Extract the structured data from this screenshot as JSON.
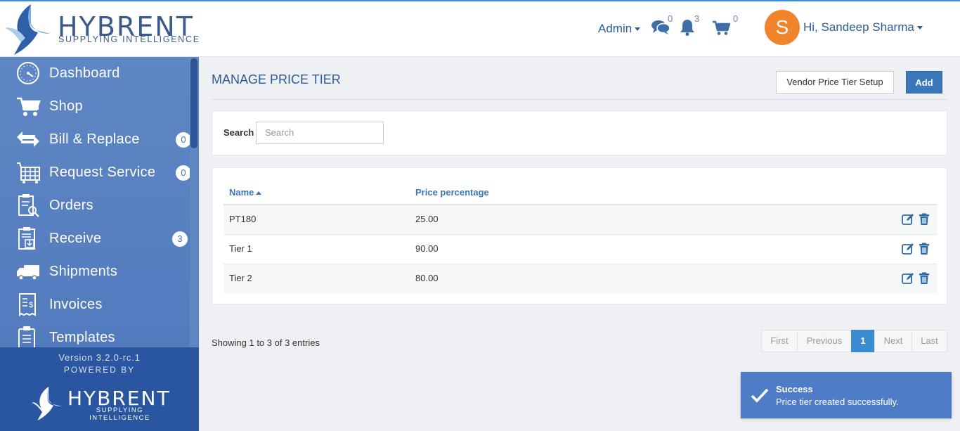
{
  "header": {
    "logo_word": "HYBRENT",
    "logo_tagline": "SUPPLYING INTELLIGENCE",
    "admin_label": "Admin",
    "messages_count": "0",
    "notifications_count": "3",
    "cart_count": "0",
    "avatar_letter": "S",
    "user_greeting": "Hi, Sandeep Sharma"
  },
  "sidebar": {
    "items": [
      {
        "label": "Dashboard",
        "icon": "dashboard-gauge-icon"
      },
      {
        "label": "Shop",
        "icon": "shopping-cart-icon"
      },
      {
        "label": "Bill & Replace",
        "icon": "replace-arrows-icon",
        "badge": "0"
      },
      {
        "label": "Request Service",
        "icon": "service-basket-icon",
        "badge": "0"
      },
      {
        "label": "Orders",
        "icon": "orders-clipboard-icon"
      },
      {
        "label": "Receive",
        "icon": "receive-clipboard-icon",
        "badge": "3"
      },
      {
        "label": "Shipments",
        "icon": "truck-icon"
      },
      {
        "label": "Invoices",
        "icon": "invoice-icon"
      },
      {
        "label": "Templates",
        "icon": "templates-clipboard-icon"
      }
    ],
    "version": "Version 3.2.0-rc.1",
    "powered_by": "POWERED BY",
    "footer_logo_word": "HYBRENT",
    "footer_logo_tagline": "SUPPLYING INTELLIGENCE"
  },
  "main": {
    "title": "MANAGE PRICE TIER",
    "vendor_button": "Vendor Price Tier Setup",
    "add_button": "Add",
    "search_label": "Search",
    "search_placeholder": "Search",
    "table": {
      "columns": [
        "Name",
        "Price percentage"
      ],
      "rows": [
        {
          "name": "PT180",
          "price": "25.00"
        },
        {
          "name": "Tier 1",
          "price": "90.00"
        },
        {
          "name": "Tier 2",
          "price": "80.00"
        }
      ]
    },
    "showing": "Showing 1 to 3 of 3 entries",
    "pagination": {
      "first": "First",
      "previous": "Previous",
      "current": "1",
      "next": "Next",
      "last": "Last"
    }
  },
  "toast": {
    "title": "Success",
    "message": "Price tier created successfully."
  },
  "colors": {
    "brand_blue": "#3a77b8",
    "sidebar_blue": "#5f87c4",
    "toast_blue": "#4f7cc7",
    "avatar_orange": "#f1832a"
  }
}
